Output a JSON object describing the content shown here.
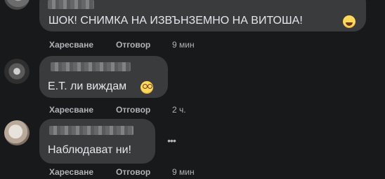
{
  "comments": [
    {
      "text": "ШОК! СНИМКА НА ИЗВЪНЗЕМНО НА ВИТОША!",
      "emoji": "rolling-on-floor-laughing-emoji",
      "like_label": "Харесване",
      "reply_label": "Отговор",
      "time": "9 мин"
    },
    {
      "text": "Е.Т. ли виждам",
      "emoji": "dizzy-face-emoji",
      "like_label": "Харесване",
      "reply_label": "Отговор",
      "time": "2 ч."
    },
    {
      "text": "Наблюдават ни!",
      "like_label": "Харесване",
      "reply_label": "Отговор",
      "time": "9 мин"
    }
  ],
  "more_icon": "more-horizontal-icon",
  "colors": {
    "background": "#18191a",
    "bubble": "#3a3b3c",
    "text": "#e4e6eb",
    "secondary_text": "#b0b3b8"
  }
}
